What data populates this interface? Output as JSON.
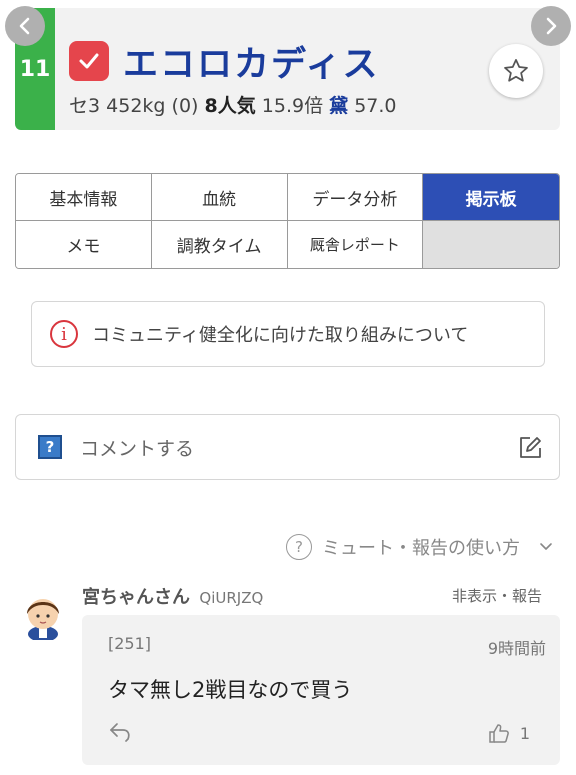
{
  "nav": {
    "prev_icon": "chevron-left-icon",
    "next_icon": "chevron-right-icon"
  },
  "horse": {
    "number": "11",
    "name": "エコロカディス",
    "sex_age": "セ3",
    "weight": "452kg",
    "weight_change": "(0)",
    "popularity": "8人気",
    "odds": "15.9倍",
    "rating_label": "黛",
    "rating_value": "57.0",
    "colors": {
      "frame": "#3bb14a",
      "name": "#1a3c9c",
      "check": "#e5454c"
    }
  },
  "tabs": [
    {
      "label": "基本情報"
    },
    {
      "label": "血統"
    },
    {
      "label": "データ分析"
    },
    {
      "label": "掲示板",
      "active": true
    },
    {
      "label": "メモ"
    },
    {
      "label": "調教タイム"
    },
    {
      "label": "厩舎レポート"
    },
    {
      "label": ""
    }
  ],
  "notice": {
    "text": "コミュニティ健全化に向けた取り組みについて"
  },
  "comment_input": {
    "placeholder": "コメントする"
  },
  "help": {
    "text": "ミュート・報告の使い方"
  },
  "comments": [
    {
      "user": "宮ちゃんさん",
      "user_id": "QiURJZQ",
      "actions": "非表示・報告",
      "number": "[251]",
      "time": "9時間前",
      "text": "タマ無し2戦目なので買う",
      "likes": "1"
    }
  ]
}
